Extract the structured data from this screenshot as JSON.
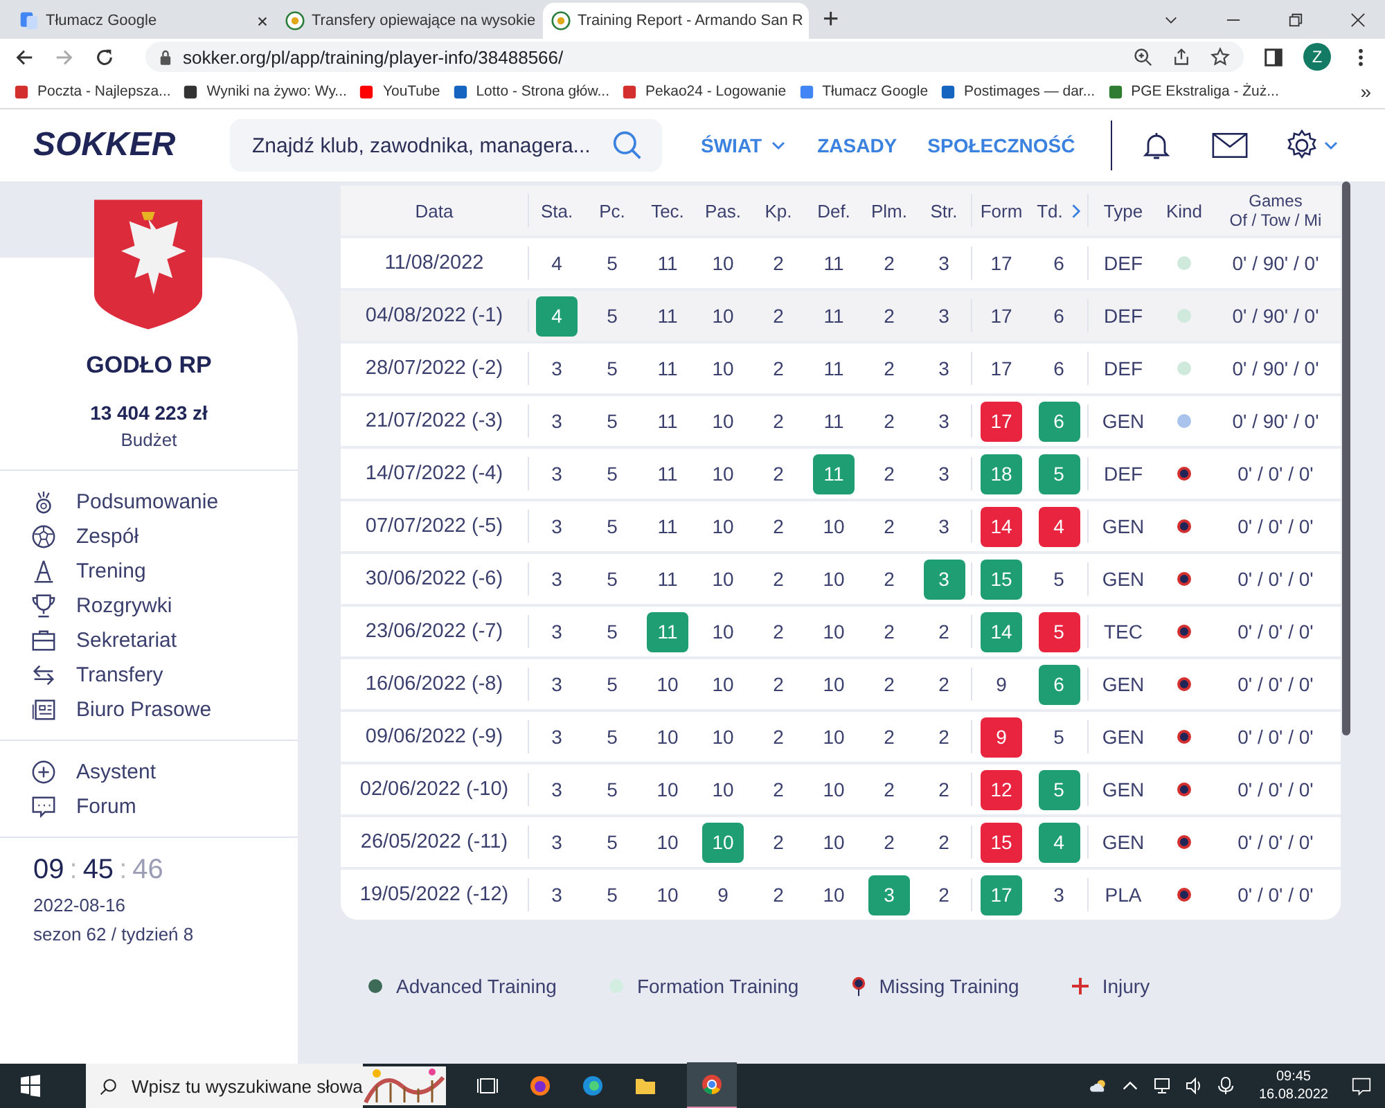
{
  "browser": {
    "tabs": [
      {
        "title": "Tłumacz Google",
        "selected": false
      },
      {
        "title": "Transfery opiewające na wysokie",
        "selected": false
      },
      {
        "title": "Training Report - Armando San R",
        "selected": true
      }
    ],
    "new_tab": "+",
    "address": "sokker.org/pl/app/training/player-info/38488566/",
    "profile": "Z",
    "bookmarks": [
      "Poczta - Najlepsza...",
      "Wyniki na żywo: Wy...",
      "YouTube",
      "Lotto - Strona głów...",
      "Pekao24 - Logowanie",
      "Tłumacz Google",
      "Postimages — dar...",
      "PGE Ekstraliga - Żuż..."
    ],
    "bookmarks_more": "»"
  },
  "header": {
    "logo": "SOKKER",
    "search": {
      "placeholder": "Znajdź klub, zawodnika, managera..."
    },
    "nav": [
      "ŚWIAT",
      "ZASADY",
      "SPOŁECZNOŚĆ"
    ]
  },
  "sidebar": {
    "club": "GODŁO RP",
    "budget": "13 404 223 zł",
    "budget_label": "Budżet",
    "menu": [
      "Podsumowanie",
      "Zespół",
      "Trening",
      "Rozgrywki",
      "Sekretariat",
      "Transfery",
      "Biuro Prasowe"
    ],
    "extra": [
      "Asystent",
      "Forum"
    ],
    "clock": {
      "hours": "09",
      "minutes": "45",
      "seconds": "46",
      "sep": ":"
    },
    "date": "2022-08-16",
    "season": "sezon 62 / tydzień 8"
  },
  "table": {
    "columns": [
      "Data",
      "Sta.",
      "Pc.",
      "Tec.",
      "Pas.",
      "Kp.",
      "Def.",
      "Plm.",
      "Str.",
      "Form",
      "Td.",
      "Type",
      "Kind"
    ],
    "games_header": [
      "Games",
      "Of / Tow / Mi"
    ],
    "rows": [
      {
        "cells": [
          {
            "text": "11/08/2022"
          },
          {
            "text": "4"
          },
          {
            "text": "5"
          },
          {
            "text": "11"
          },
          {
            "text": "10"
          },
          {
            "text": "2"
          },
          {
            "text": "11"
          },
          {
            "text": "2"
          },
          {
            "text": "3"
          },
          {
            "text": "17"
          },
          {
            "text": "6"
          },
          {
            "text": "DEF"
          }
        ],
        "kind": "dot",
        "color": "#cfe9dc",
        "games": "0' / 90' / 0'",
        "hovered": false
      },
      {
        "cells": [
          {
            "text": "04/08/2022 (-1)"
          },
          {
            "text": "4",
            "color": "#1f9e74"
          },
          {
            "text": "5"
          },
          {
            "text": "11"
          },
          {
            "text": "10"
          },
          {
            "text": "2"
          },
          {
            "text": "11"
          },
          {
            "text": "2"
          },
          {
            "text": "3"
          },
          {
            "text": "17"
          },
          {
            "text": "6"
          },
          {
            "text": "DEF"
          }
        ],
        "kind": "dot",
        "color": "#cfe9dc",
        "games": "0' / 90' / 0'",
        "hovered": true
      },
      {
        "cells": [
          {
            "text": "28/07/2022 (-2)"
          },
          {
            "text": "3"
          },
          {
            "text": "5"
          },
          {
            "text": "11"
          },
          {
            "text": "10"
          },
          {
            "text": "2"
          },
          {
            "text": "11"
          },
          {
            "text": "2"
          },
          {
            "text": "3"
          },
          {
            "text": "17"
          },
          {
            "text": "6"
          },
          {
            "text": "DEF"
          }
        ],
        "kind": "dot",
        "color": "#cfe9dc",
        "games": "0' / 90' / 0'",
        "hovered": false
      },
      {
        "cells": [
          {
            "text": "21/07/2022 (-3)"
          },
          {
            "text": "3"
          },
          {
            "text": "5"
          },
          {
            "text": "11"
          },
          {
            "text": "10"
          },
          {
            "text": "2"
          },
          {
            "text": "11"
          },
          {
            "text": "2"
          },
          {
            "text": "3"
          },
          {
            "text": "17",
            "color": "#e8243f"
          },
          {
            "text": "6",
            "color": "#1f9e74"
          },
          {
            "text": "GEN"
          }
        ],
        "kind": "dot",
        "color": "#a9c3ec",
        "games": "0' / 90' / 0'",
        "hovered": false
      },
      {
        "cells": [
          {
            "text": "14/07/2022 (-4)"
          },
          {
            "text": "3"
          },
          {
            "text": "5"
          },
          {
            "text": "11"
          },
          {
            "text": "10"
          },
          {
            "text": "2"
          },
          {
            "text": "11",
            "color": "#1f9e74"
          },
          {
            "text": "2"
          },
          {
            "text": "3"
          },
          {
            "text": "18",
            "color": "#1f9e74"
          },
          {
            "text": "5",
            "color": "#1f9e74"
          },
          {
            "text": "DEF"
          }
        ],
        "kind": "missing",
        "games": "0' / 0' / 0'",
        "hovered": false
      },
      {
        "cells": [
          {
            "text": "07/07/2022 (-5)"
          },
          {
            "text": "3"
          },
          {
            "text": "5"
          },
          {
            "text": "11"
          },
          {
            "text": "10"
          },
          {
            "text": "2"
          },
          {
            "text": "10"
          },
          {
            "text": "2"
          },
          {
            "text": "3"
          },
          {
            "text": "14",
            "color": "#e8243f"
          },
          {
            "text": "4",
            "color": "#e8243f"
          },
          {
            "text": "GEN"
          }
        ],
        "kind": "missing",
        "games": "0' / 0' / 0'",
        "hovered": false
      },
      {
        "cells": [
          {
            "text": "30/06/2022 (-6)"
          },
          {
            "text": "3"
          },
          {
            "text": "5"
          },
          {
            "text": "11"
          },
          {
            "text": "10"
          },
          {
            "text": "2"
          },
          {
            "text": "10"
          },
          {
            "text": "2"
          },
          {
            "text": "3",
            "color": "#1f9e74"
          },
          {
            "text": "15",
            "color": "#1f9e74"
          },
          {
            "text": "5"
          },
          {
            "text": "GEN"
          }
        ],
        "kind": "missing",
        "games": "0' / 0' / 0'",
        "hovered": false
      },
      {
        "cells": [
          {
            "text": "23/06/2022 (-7)"
          },
          {
            "text": "3"
          },
          {
            "text": "5"
          },
          {
            "text": "11",
            "color": "#1f9e74"
          },
          {
            "text": "10"
          },
          {
            "text": "2"
          },
          {
            "text": "10"
          },
          {
            "text": "2"
          },
          {
            "text": "2"
          },
          {
            "text": "14",
            "color": "#1f9e74"
          },
          {
            "text": "5",
            "color": "#e8243f"
          },
          {
            "text": "TEC"
          }
        ],
        "kind": "missing",
        "games": "0' / 0' / 0'",
        "hovered": false
      },
      {
        "cells": [
          {
            "text": "16/06/2022 (-8)"
          },
          {
            "text": "3"
          },
          {
            "text": "5"
          },
          {
            "text": "10"
          },
          {
            "text": "10"
          },
          {
            "text": "2"
          },
          {
            "text": "10"
          },
          {
            "text": "2"
          },
          {
            "text": "2"
          },
          {
            "text": "9"
          },
          {
            "text": "6",
            "color": "#1f9e74"
          },
          {
            "text": "GEN"
          }
        ],
        "kind": "missing",
        "games": "0' / 0' / 0'",
        "hovered": false
      },
      {
        "cells": [
          {
            "text": "09/06/2022 (-9)"
          },
          {
            "text": "3"
          },
          {
            "text": "5"
          },
          {
            "text": "10"
          },
          {
            "text": "10"
          },
          {
            "text": "2"
          },
          {
            "text": "10"
          },
          {
            "text": "2"
          },
          {
            "text": "2"
          },
          {
            "text": "9",
            "color": "#e8243f"
          },
          {
            "text": "5"
          },
          {
            "text": "GEN"
          }
        ],
        "kind": "missing",
        "games": "0' / 0' / 0'",
        "hovered": false
      },
      {
        "cells": [
          {
            "text": "02/06/2022 (-10)"
          },
          {
            "text": "3"
          },
          {
            "text": "5"
          },
          {
            "text": "10"
          },
          {
            "text": "10"
          },
          {
            "text": "2"
          },
          {
            "text": "10"
          },
          {
            "text": "2"
          },
          {
            "text": "2"
          },
          {
            "text": "12",
            "color": "#e8243f"
          },
          {
            "text": "5",
            "color": "#1f9e74"
          },
          {
            "text": "GEN"
          }
        ],
        "kind": "missing",
        "games": "0' / 0' / 0'",
        "hovered": false
      },
      {
        "cells": [
          {
            "text": "26/05/2022 (-11)"
          },
          {
            "text": "3"
          },
          {
            "text": "5"
          },
          {
            "text": "10"
          },
          {
            "text": "10",
            "color": "#1f9e74"
          },
          {
            "text": "2"
          },
          {
            "text": "10"
          },
          {
            "text": "2"
          },
          {
            "text": "2"
          },
          {
            "text": "15",
            "color": "#e8243f"
          },
          {
            "text": "4",
            "color": "#1f9e74"
          },
          {
            "text": "GEN"
          }
        ],
        "kind": "missing",
        "games": "0' / 0' / 0'",
        "hovered": false
      },
      {
        "cells": [
          {
            "text": "19/05/2022 (-12)"
          },
          {
            "text": "3"
          },
          {
            "text": "5"
          },
          {
            "text": "10"
          },
          {
            "text": "9"
          },
          {
            "text": "2"
          },
          {
            "text": "10"
          },
          {
            "text": "3",
            "color": "#1f9e74"
          },
          {
            "text": "2"
          },
          {
            "text": "17",
            "color": "#1f9e74"
          },
          {
            "text": "3"
          },
          {
            "text": "PLA"
          }
        ],
        "kind": "missing",
        "games": "0' / 0' / 0'",
        "hovered": false
      }
    ]
  },
  "legend": [
    {
      "label": "Advanced Training",
      "kind": "dot",
      "color": "#3d6b58"
    },
    {
      "label": "Formation Training",
      "kind": "dot",
      "color": "#d3eee0"
    },
    {
      "label": "Missing Training",
      "kind": "pin"
    },
    {
      "label": "Injury",
      "kind": "plus"
    }
  ],
  "taskbar": {
    "search": {
      "placeholder": "Wpisz tu wyszukiwane słowa"
    },
    "time": "09:45",
    "date": "16.08.2022"
  }
}
